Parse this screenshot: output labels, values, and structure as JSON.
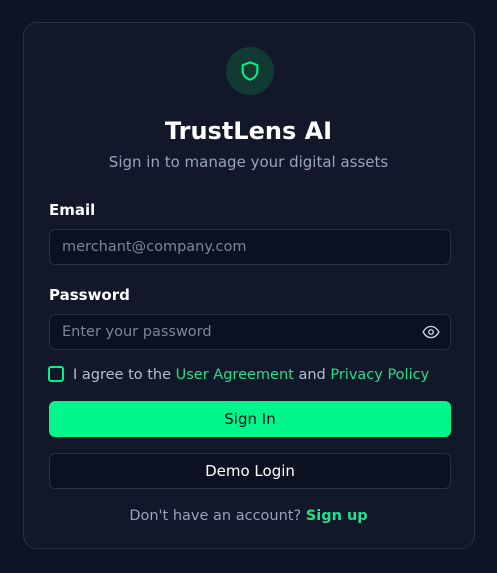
{
  "app": {
    "title": "TrustLens AI",
    "subtitle": "Sign in to manage your digital assets"
  },
  "form": {
    "email_label": "Email",
    "email_placeholder": "merchant@company.com",
    "password_label": "Password",
    "password_placeholder": "Enter your password",
    "agree_prefix": "I agree to the ",
    "user_agreement": "User Agreement",
    "agree_and": " and ",
    "privacy_policy": "Privacy Policy",
    "agree_checked": false
  },
  "buttons": {
    "sign_in": "Sign In",
    "demo_login": "Demo Login"
  },
  "footer": {
    "prompt": "Don't have an account? ",
    "signup": "Sign up"
  },
  "colors": {
    "accent": "#00f58a",
    "background": "#0f1424",
    "card": "#121829"
  },
  "icons": {
    "logo": "shield-icon",
    "password_toggle": "eye-icon"
  }
}
